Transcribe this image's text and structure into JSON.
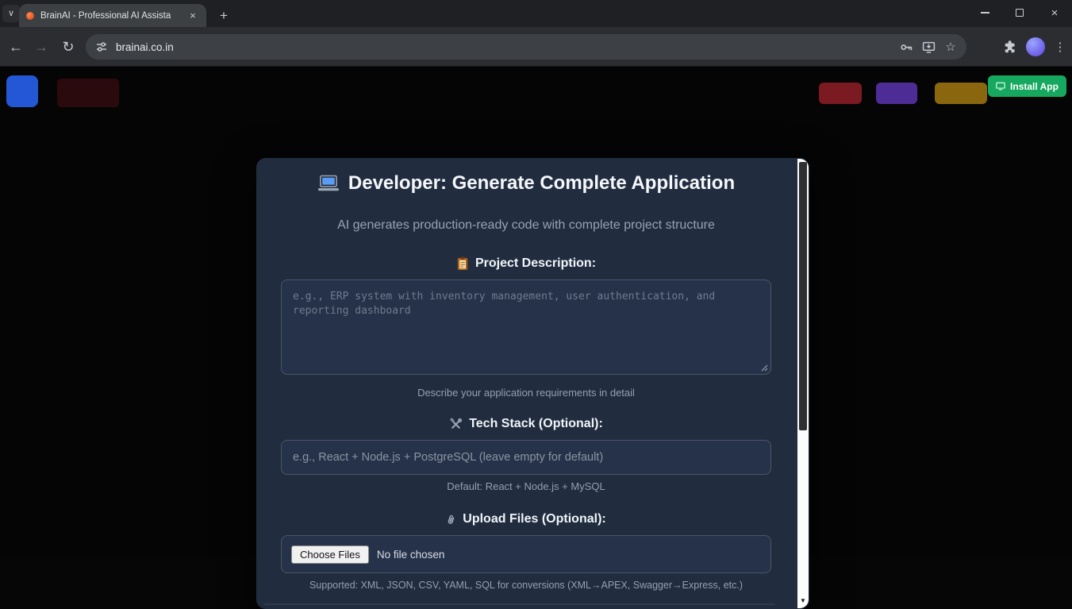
{
  "browser": {
    "tab_title": "BrainAI - Professional AI Assista",
    "url": "brainai.co.in"
  },
  "header": {
    "install_app_label": "Install App"
  },
  "colors": {
    "install_green": "#16a85f",
    "logo_blue": "#2457d6",
    "dim_red": "#7c1a22",
    "dim_purple": "#4e2c96",
    "dim_amber": "#8a670f",
    "modal_bg": "#212d3f"
  },
  "modal": {
    "title": "Developer: Generate Complete Application",
    "subtitle": "AI generates production-ready code with complete project structure",
    "project": {
      "label": "Project Description:",
      "placeholder": "e.g., ERP system with inventory management, user authentication, and reporting dashboard",
      "helper": "Describe your application requirements in detail"
    },
    "tech": {
      "label": "Tech Stack (Optional):",
      "placeholder": "e.g., React + Node.js + PostgreSQL (leave empty for default)",
      "helper": "Default: React + Node.js + MySQL"
    },
    "upload": {
      "label": "Upload Files (Optional):",
      "button_label": "Choose Files",
      "status": "No file chosen",
      "helper": "Supported: XML, JSON, CSV, YAML, SQL for conversions (XML→APEX, Swagger→Express, etc.)"
    }
  }
}
